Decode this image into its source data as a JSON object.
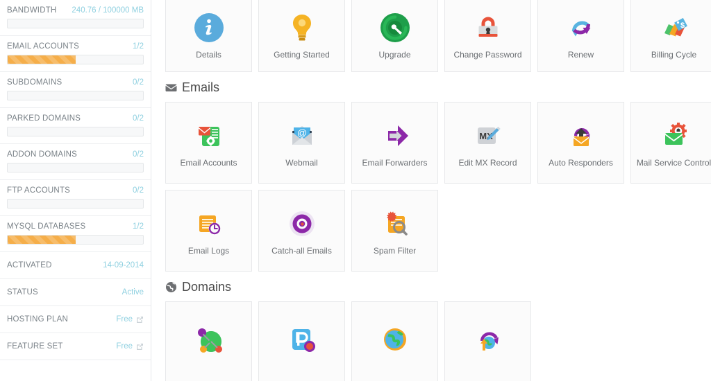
{
  "sidebar": {
    "stats": [
      {
        "label": "BANDWIDTH",
        "value": "240.76 / 100000 MB",
        "percent": 0,
        "type": "progress"
      },
      {
        "label": "EMAIL ACCOUNTS",
        "value": "1/2",
        "percent": 50,
        "type": "progress"
      },
      {
        "label": "SUBDOMAINS",
        "value": "0/2",
        "percent": 0,
        "type": "progress"
      },
      {
        "label": "PARKED DOMAINS",
        "value": "0/2",
        "percent": 0,
        "type": "progress"
      },
      {
        "label": "ADDON DOMAINS",
        "value": "0/2",
        "percent": 0,
        "type": "progress"
      },
      {
        "label": "FTP ACCOUNTS",
        "value": "0/2",
        "percent": 0,
        "type": "progress"
      },
      {
        "label": "MYSQL DATABASES",
        "value": "1/2",
        "percent": 50,
        "type": "progress"
      }
    ],
    "info": [
      {
        "label": "ACTIVATED",
        "value": "14-09-2014",
        "link": false
      },
      {
        "label": "STATUS",
        "value": "Active",
        "link": false
      },
      {
        "label": "HOSTING PLAN",
        "value": "Free",
        "link": true
      },
      {
        "label": "FEATURE SET",
        "value": "Free",
        "link": true
      }
    ]
  },
  "main": {
    "top_row": {
      "cards": [
        {
          "label": "Details",
          "icon": "info-circle-icon"
        },
        {
          "label": "Getting Started",
          "icon": "lightbulb-icon"
        },
        {
          "label": "Upgrade",
          "icon": "gauge-circle-icon"
        },
        {
          "label": "Change Password",
          "icon": "padlock-icon"
        },
        {
          "label": "Renew",
          "icon": "refresh-arrows-icon"
        },
        {
          "label": "Billing Cycle",
          "icon": "price-tags-icon"
        }
      ]
    },
    "sections": [
      {
        "title": "Emails",
        "icon": "envelope-icon",
        "cards": [
          {
            "label": "Email Accounts",
            "icon": "email-accounts-icon"
          },
          {
            "label": "Webmail",
            "icon": "webmail-at-icon"
          },
          {
            "label": "Email Forwarders",
            "icon": "forward-arrow-icon"
          },
          {
            "label": "Edit MX Record",
            "icon": "mx-pencil-icon"
          },
          {
            "label": "Auto Responders",
            "icon": "auto-responder-icon"
          },
          {
            "label": "Mail Service Control",
            "icon": "mail-gear-icon"
          },
          {
            "label": "Email Logs",
            "icon": "email-logs-clock-icon"
          },
          {
            "label": "Catch-all Emails",
            "icon": "catchall-target-icon"
          },
          {
            "label": "Spam Filter",
            "icon": "spam-filter-icon"
          }
        ]
      },
      {
        "title": "Domains",
        "icon": "globe-icon",
        "cards": [
          {
            "label": "",
            "icon": "subdomains-globe-icon"
          },
          {
            "label": "",
            "icon": "parked-domain-p-icon"
          },
          {
            "label": "",
            "icon": "addon-domain-globe-icon"
          },
          {
            "label": "",
            "icon": "redirect-globe-icon"
          }
        ]
      }
    ]
  },
  "colors": {
    "accent_blue": "#8fd0e0",
    "progress_orange": "#f5ae4a",
    "label_gray": "#7a8288",
    "card_bg": "#fbfbfb",
    "card_border": "#e7e8ea"
  }
}
